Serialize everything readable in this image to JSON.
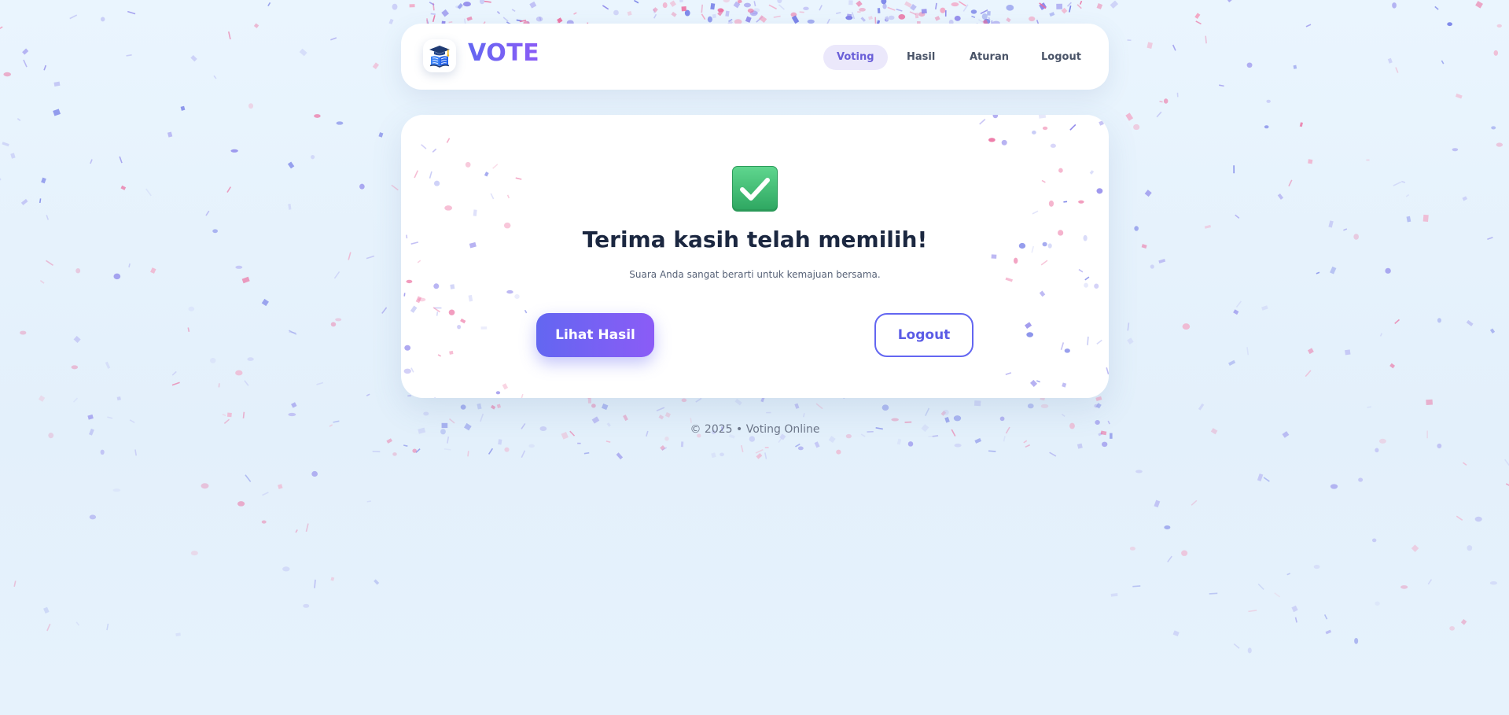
{
  "navbar": {
    "logo_icon": "graduation-book-icon",
    "brand": "VOTE",
    "items": [
      {
        "label": "Voting",
        "active": true
      },
      {
        "label": "Hasil",
        "active": false
      },
      {
        "label": "Aturan",
        "active": false
      },
      {
        "label": "Logout",
        "active": false
      }
    ]
  },
  "card": {
    "icon": "check-mark-icon",
    "title": "Terima kasih telah memilih!",
    "subtitle": "Suara Anda sangat berarti untuk kemajuan bersama.",
    "primary_button": "Lihat Hasil",
    "secondary_button": "Logout"
  },
  "footer": {
    "text": "© 2025 • Voting Online"
  },
  "colors": {
    "accent_start": "#6366f1",
    "accent_end": "#8b5cf6",
    "active_nav_bg": "#ebe8fb",
    "check_green": "#3fbf74",
    "confetti_pink": "#ec6ea0",
    "confetti_purple": "#8b83ea"
  }
}
